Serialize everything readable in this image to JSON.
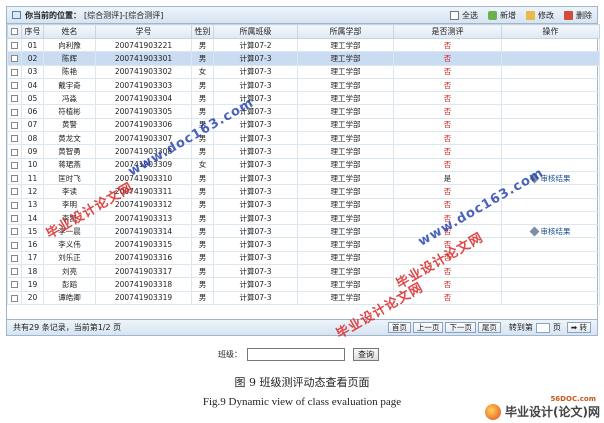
{
  "header": {
    "location_label": "你当前的位置：",
    "location_path": "[综合测评]-[综合测评]"
  },
  "toolbar": {
    "select_all": "全选",
    "add": "新增",
    "edit": "修改",
    "delete": "删除"
  },
  "table": {
    "columns": [
      "序号",
      "姓名",
      "学号",
      "性别",
      "所属班级",
      "所属学部",
      "是否测评",
      "操作"
    ],
    "rows": [
      {
        "no": "01",
        "name": "向利豫",
        "sid": "200741903221",
        "sex": "男",
        "class": "计算07-2",
        "dept": "理工学部",
        "evaluated": "否",
        "action": ""
      },
      {
        "no": "02",
        "name": "陈辉",
        "sid": "200741903301",
        "sex": "男",
        "class": "计算07-3",
        "dept": "理工学部",
        "evaluated": "否",
        "action": ""
      },
      {
        "no": "03",
        "name": "陈艳",
        "sid": "200741903302",
        "sex": "女",
        "class": "计算07-3",
        "dept": "理工学部",
        "evaluated": "否",
        "action": ""
      },
      {
        "no": "04",
        "name": "戴宇奇",
        "sid": "200741903303",
        "sex": "男",
        "class": "计算07-3",
        "dept": "理工学部",
        "evaluated": "否",
        "action": ""
      },
      {
        "no": "05",
        "name": "冯淼",
        "sid": "200741903304",
        "sex": "男",
        "class": "计算07-3",
        "dept": "理工学部",
        "evaluated": "否",
        "action": ""
      },
      {
        "no": "06",
        "name": "符植彬",
        "sid": "200741903305",
        "sex": "男",
        "class": "计算07-3",
        "dept": "理工学部",
        "evaluated": "否",
        "action": ""
      },
      {
        "no": "07",
        "name": "黄警",
        "sid": "200741903306",
        "sex": "男",
        "class": "计算07-3",
        "dept": "理工学部",
        "evaluated": "否",
        "action": ""
      },
      {
        "no": "08",
        "name": "黄龙文",
        "sid": "200741903307",
        "sex": "男",
        "class": "计算07-3",
        "dept": "理工学部",
        "evaluated": "否",
        "action": ""
      },
      {
        "no": "09",
        "name": "黄智勇",
        "sid": "200741903308",
        "sex": "男",
        "class": "计算07-3",
        "dept": "理工学部",
        "evaluated": "否",
        "action": ""
      },
      {
        "no": "10",
        "name": "蒋珺燕",
        "sid": "200741903309",
        "sex": "女",
        "class": "计算07-3",
        "dept": "理工学部",
        "evaluated": "否",
        "action": ""
      },
      {
        "no": "11",
        "name": "匡时飞",
        "sid": "200741903310",
        "sex": "男",
        "class": "计算07-3",
        "dept": "理工学部",
        "evaluated": "是",
        "action": "审核结果"
      },
      {
        "no": "12",
        "name": "李读",
        "sid": "200741903311",
        "sex": "男",
        "class": "计算07-3",
        "dept": "理工学部",
        "evaluated": "否",
        "action": ""
      },
      {
        "no": "13",
        "name": "李明",
        "sid": "200741903312",
        "sex": "男",
        "class": "计算07-3",
        "dept": "理工学部",
        "evaluated": "否",
        "action": ""
      },
      {
        "no": "14",
        "name": "李凯",
        "sid": "200741903313",
        "sex": "男",
        "class": "计算07-3",
        "dept": "理工学部",
        "evaluated": "否",
        "action": ""
      },
      {
        "no": "15",
        "name": "李一晨",
        "sid": "200741903314",
        "sex": "男",
        "class": "计算07-3",
        "dept": "理工学部",
        "evaluated": "否",
        "action": "审核结果"
      },
      {
        "no": "16",
        "name": "李义伟",
        "sid": "200741903315",
        "sex": "男",
        "class": "计算07-3",
        "dept": "理工学部",
        "evaluated": "否",
        "action": ""
      },
      {
        "no": "17",
        "name": "刘乐正",
        "sid": "200741903316",
        "sex": "男",
        "class": "计算07-3",
        "dept": "理工学部",
        "evaluated": "否",
        "action": ""
      },
      {
        "no": "18",
        "name": "刘亮",
        "sid": "200741903317",
        "sex": "男",
        "class": "计算07-3",
        "dept": "理工学部",
        "evaluated": "否",
        "action": ""
      },
      {
        "no": "19",
        "name": "彭蹈",
        "sid": "200741903318",
        "sex": "男",
        "class": "计算07-3",
        "dept": "理工学部",
        "evaluated": "否",
        "action": ""
      },
      {
        "no": "20",
        "name": "谭皓卿",
        "sid": "200741903319",
        "sex": "男",
        "class": "计算07-3",
        "dept": "理工学部",
        "evaluated": "否",
        "action": ""
      }
    ]
  },
  "footer": {
    "summary": "共有29 条记录，当前第1/2 页",
    "first": "首页",
    "prev": "上一页",
    "next": "下一页",
    "last": "尾页",
    "goto_label": "转到第",
    "page_unit": "页",
    "go": "转"
  },
  "search": {
    "label": "班级：",
    "button": "查询"
  },
  "caption": {
    "cn": "图 9    班级测评动态查看页面",
    "en": "Fig.9    Dynamic view of class evaluation page"
  },
  "watermarks": {
    "brand": "毕业设计论文网",
    "site": "www.doc163.com",
    "logo_site": "56DOC.com",
    "logo_text": "毕业设计(论文)网"
  },
  "colors": {
    "accent": "#9fb6cc",
    "selected_row": "#c9dcf1",
    "negative": "#d3281f"
  },
  "selected_row_index": 1
}
